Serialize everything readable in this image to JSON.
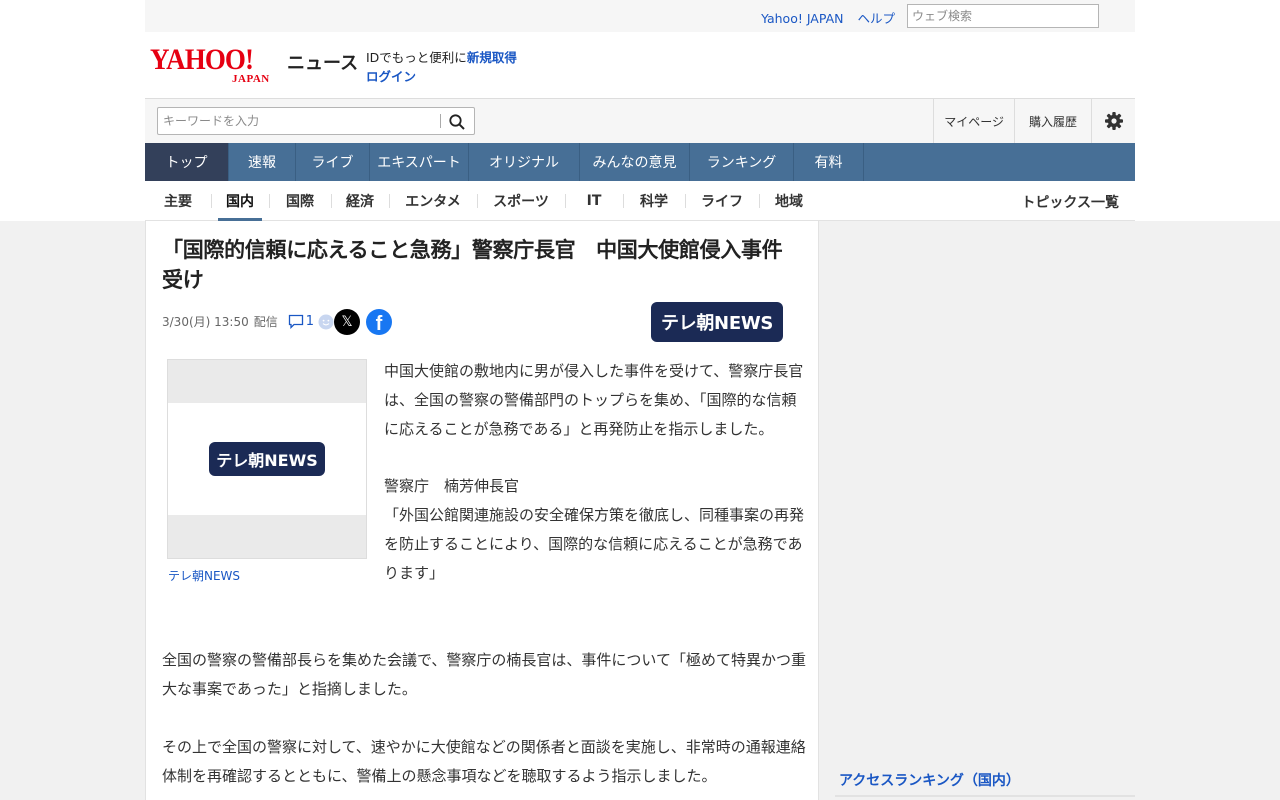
{
  "header": {
    "links": [
      "Yahoo! JAPAN",
      "ヘルプ"
    ],
    "web_search_placeholder": "ウェブ検索",
    "logo_main": "YAHOO!",
    "logo_sub": "JAPAN",
    "service": "ニュース",
    "promo_text": "IDでもっと便利に",
    "promo_signup": "新規取得",
    "login": "ログイン"
  },
  "search": {
    "placeholder": "キーワードを入力",
    "mypage": "マイページ",
    "purchase_history": "購入履歴",
    "settings_icon": "gear-icon"
  },
  "global_nav": [
    "トップ",
    "速報",
    "ライブ",
    "エキスパート",
    "オリジナル",
    "みんなの意見",
    "ランキング",
    "有料"
  ],
  "global_nav_active": "トップ",
  "local_nav": [
    "主要",
    "国内",
    "国際",
    "経済",
    "エンタメ",
    "スポーツ",
    "IT",
    "科学",
    "ライフ",
    "地域"
  ],
  "local_nav_active": "国内",
  "topics_link": "トピックス一覧",
  "article": {
    "title": "「国際的信頼に応えること急務」警察庁長官　中国大使館侵入事件受け",
    "date": "3/30(月) 13:50",
    "delivered": "配信",
    "comment_count": "1",
    "provider": "テレ朝NEWS",
    "photo_badge": "テレ朝NEWS",
    "photo_caption": "テレ朝NEWS",
    "para1": "中国大使館の敷地内に男が侵入した事件を受けて、警察庁長官は、全国の警察の警備部門のトップらを集め、「国際的な信頼に応えることが急務である」と再発防止を指示しました。",
    "para2_line1": "警察庁　楠芳伸長官",
    "para2_line2": "「外国公館関連施設の安全確保方策を徹底し、同種事案の再発を防止することにより、国際的な信頼に応えることが急務であります」",
    "para3": "全国の警察の警備部長らを集めた会議で、警察庁の楠長官は、事件について「極めて特異かつ重大な事案であった」と指摘しました。",
    "para4": "その上で全国の警察に対して、速やかに大使館などの関係者と面談を実施し、非常時の通報連絡体制を再確認するとともに、警備上の懸念事項などを聴取するよう指示しました。"
  },
  "sidebar": {
    "ranking_title": "アクセスランキング（国内）"
  },
  "colors": {
    "nav_bg": "#476f96",
    "nav_active": "#33405a",
    "link": "#1a57c4",
    "yahoo_red": "#e60012",
    "provider_navy": "#1b2a55"
  }
}
